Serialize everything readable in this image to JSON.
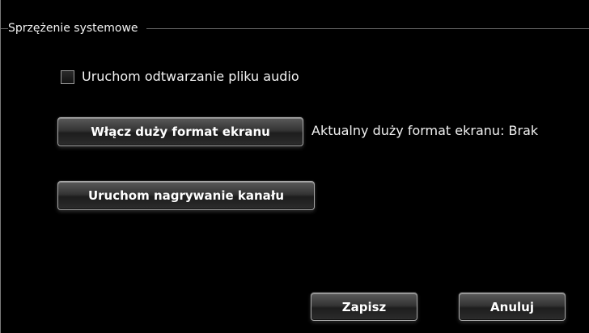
{
  "group": {
    "title": "Sprzężenie systemowe"
  },
  "options": {
    "audio_playback_label": "Uruchom odtwarzanie pliku audio",
    "audio_playback_checked": false
  },
  "actions": {
    "large_screen_button": "Włącz duży format ekranu",
    "current_large_screen_text": "Aktualny duży format ekranu: Brak",
    "channel_recording_button": "Uruchom nagrywanie kanału"
  },
  "footer": {
    "save_label": "Zapisz",
    "cancel_label": "Anuluj"
  },
  "colors": {
    "background": "#000000",
    "text": "#ffffff",
    "border": "#7a7a7a"
  }
}
